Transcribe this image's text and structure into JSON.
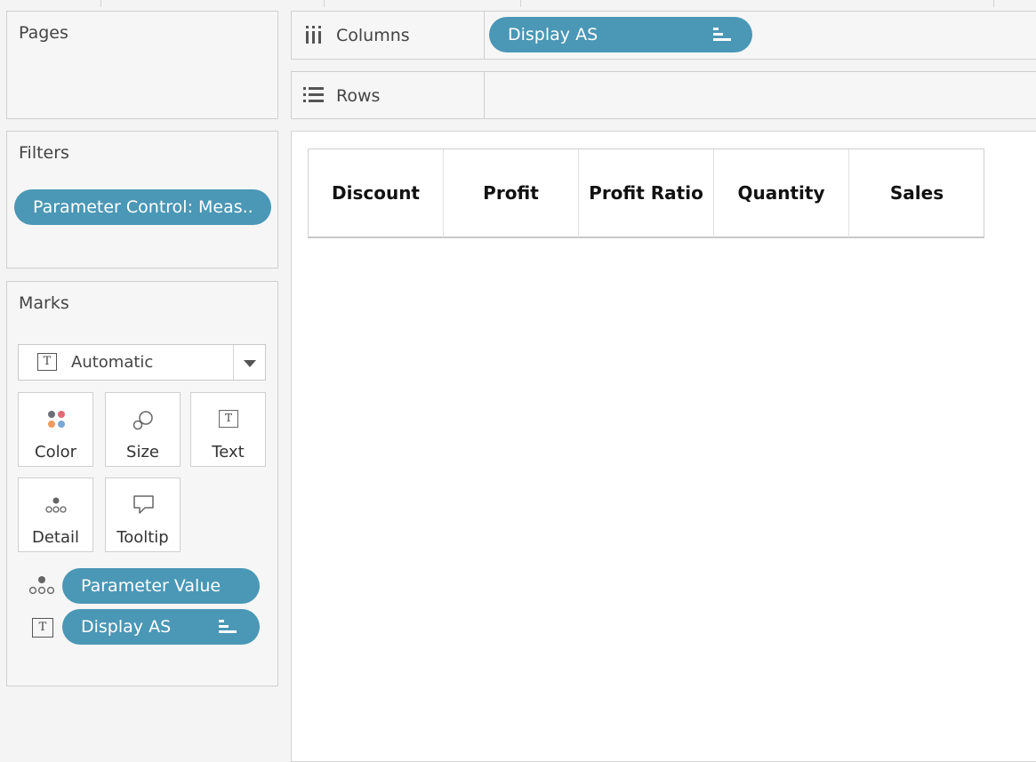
{
  "cards": {
    "pages": {
      "title": "Pages"
    },
    "filters": {
      "title": "Filters",
      "pill": "Parameter Control: Meas.."
    },
    "marks": {
      "title": "Marks",
      "mark_type": "Automatic",
      "buttons": {
        "color": "Color",
        "size": "Size",
        "text": "Text",
        "detail": "Detail",
        "tooltip": "Tooltip"
      },
      "fields": [
        {
          "icon": "detail-icon",
          "label": "Parameter Value"
        },
        {
          "icon": "text-icon",
          "label": "Display AS"
        }
      ]
    }
  },
  "shelves": {
    "columns": {
      "label": "Columns",
      "pill": "Display AS"
    },
    "rows": {
      "label": "Rows"
    }
  },
  "view": {
    "headers": [
      "Discount",
      "Profit",
      "Profit Ratio",
      "Quantity",
      "Sales"
    ]
  },
  "colors": {
    "pill": "#4a97b6",
    "panel": "#f6f6f6",
    "border": "#cfcfcf"
  }
}
